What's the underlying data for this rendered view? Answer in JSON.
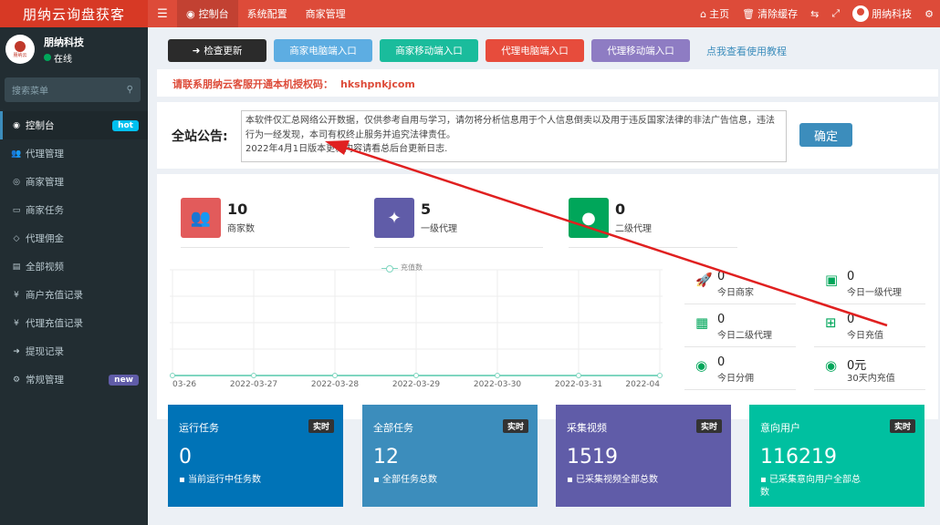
{
  "app": {
    "title": "朋纳云询盘获客"
  },
  "topnav": [
    {
      "label": "控制台",
      "icon": "dashboard-icon"
    },
    {
      "label": "系统配置"
    },
    {
      "label": "商家管理"
    }
  ],
  "topright": {
    "home": "主页",
    "clear_cache": "清除缓存",
    "username": "朋纳科技"
  },
  "user": {
    "name": "朋纳科技",
    "status": "在线",
    "logo_text": "朋纳云"
  },
  "search": {
    "placeholder": "搜索菜单"
  },
  "sidebar": {
    "items": [
      {
        "label": "控制台",
        "icon": "dashboard-icon",
        "badge": "hot"
      },
      {
        "label": "代理管理",
        "icon": "users-icon"
      },
      {
        "label": "商家管理",
        "icon": "eye-icon"
      },
      {
        "label": "商家任务",
        "icon": "keyboard-icon"
      },
      {
        "label": "代理佣金",
        "icon": "diamond-icon"
      },
      {
        "label": "全部视频",
        "icon": "file-icon"
      },
      {
        "label": "商户充值记录",
        "icon": "yen-icon"
      },
      {
        "label": "代理充值记录",
        "icon": "yen-icon"
      },
      {
        "label": "提现记录",
        "icon": "sign-in-icon"
      },
      {
        "label": "常规管理",
        "icon": "cogs-icon",
        "badge": "new"
      }
    ]
  },
  "actions": {
    "check_update": "检查更新",
    "merchant_pc": "商家电脑端入口",
    "merchant_mobile": "商家移动端入口",
    "agent_pc": "代理电脑端入口",
    "agent_mobile": "代理移动端入口",
    "tutorial": "点我查看使用教程"
  },
  "auth": {
    "text": "请联系朋纳云客服开通本机授权码：",
    "code": "hkshpnkjcom"
  },
  "notice": {
    "label": "全站公告:",
    "text": "本软件仅汇总网络公开数据，仅供参考自用与学习，请勿将分析信息用于个人信息倒卖以及用于违反国家法律的非法广告信息，违法行为一经发现，本司有权终止服务并追究法律责任。\n2022年4月1日版本更新内容请看总后台更新日志.",
    "confirm": "确定"
  },
  "stats": [
    {
      "value": "10",
      "label": "商家数",
      "icon": "users-icon",
      "color": "#dd4b39"
    },
    {
      "value": "5",
      "label": "一级代理",
      "icon": "magic-icon",
      "color": "#605ca8"
    },
    {
      "value": "0",
      "label": "二级代理",
      "icon": "user-icon",
      "color": "#00a65a"
    }
  ],
  "chart_data": {
    "type": "line",
    "title": "",
    "legend": "充值数",
    "x": [
      "03-26",
      "2022-03-27",
      "2022-03-28",
      "2022-03-29",
      "2022-03-30",
      "2022-03-31",
      "2022-04"
    ],
    "series": [
      {
        "name": "充值数",
        "values": [
          0,
          0,
          0,
          0,
          0,
          0,
          0
        ]
      }
    ],
    "color": "#7fd6c0",
    "grid": true
  },
  "mini_stats": [
    {
      "value": "0",
      "label": "今日商家",
      "icon": "rocket-icon"
    },
    {
      "value": "0",
      "label": "今日一级代理",
      "icon": "id-card-icon"
    },
    {
      "value": "0",
      "label": "今日二级代理",
      "icon": "calendar-icon"
    },
    {
      "value": "0",
      "label": "今日充值",
      "icon": "calendar-plus-icon"
    },
    {
      "value": "0",
      "label": "今日分佣",
      "icon": "user-circle-icon"
    },
    {
      "value": "0元",
      "label": "30天内充值",
      "icon": "user-circle-icon"
    }
  ],
  "cards": [
    {
      "title": "运行任务",
      "tag": "实时",
      "value": "0",
      "sub": "当前运行中任务数",
      "icon": "magic-icon",
      "color": "#0073b7"
    },
    {
      "title": "全部任务",
      "tag": "实时",
      "value": "12",
      "sub": "全部任务总数",
      "icon": "file-icon",
      "color": "#3c8dbc"
    },
    {
      "title": "采集视频",
      "tag": "实时",
      "value": "1519",
      "sub": "已采集视频全部总数",
      "icon": "camera-icon",
      "color": "#605ca8"
    },
    {
      "title": "意向用户",
      "tag": "实时",
      "value": "116219",
      "sub": "已采集意向用户全部总数",
      "icon": "image-icon",
      "color": "#00c0a0"
    }
  ]
}
